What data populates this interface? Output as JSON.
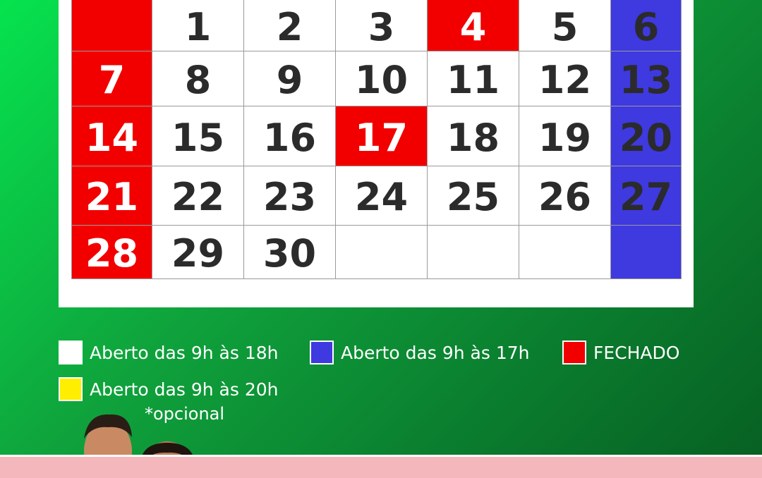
{
  "calendar": {
    "rows": [
      [
        {
          "d": "",
          "c": "red"
        },
        {
          "d": "1",
          "c": "white"
        },
        {
          "d": "2",
          "c": "white"
        },
        {
          "d": "3",
          "c": "white"
        },
        {
          "d": "4",
          "c": "red"
        },
        {
          "d": "5",
          "c": "white"
        },
        {
          "d": "6",
          "c": "blue"
        }
      ],
      [
        {
          "d": "7",
          "c": "red"
        },
        {
          "d": "8",
          "c": "white"
        },
        {
          "d": "9",
          "c": "white"
        },
        {
          "d": "10",
          "c": "white"
        },
        {
          "d": "11",
          "c": "white"
        },
        {
          "d": "12",
          "c": "white"
        },
        {
          "d": "13",
          "c": "blue"
        }
      ],
      [
        {
          "d": "14",
          "c": "red"
        },
        {
          "d": "15",
          "c": "white"
        },
        {
          "d": "16",
          "c": "white"
        },
        {
          "d": "17",
          "c": "red"
        },
        {
          "d": "18",
          "c": "white"
        },
        {
          "d": "19",
          "c": "white"
        },
        {
          "d": "20",
          "c": "blue"
        }
      ],
      [
        {
          "d": "21",
          "c": "red"
        },
        {
          "d": "22",
          "c": "white"
        },
        {
          "d": "23",
          "c": "white"
        },
        {
          "d": "24",
          "c": "white"
        },
        {
          "d": "25",
          "c": "white"
        },
        {
          "d": "26",
          "c": "white"
        },
        {
          "d": "27",
          "c": "blue"
        }
      ],
      [
        {
          "d": "28",
          "c": "red"
        },
        {
          "d": "29",
          "c": "white"
        },
        {
          "d": "30",
          "c": "white"
        },
        {
          "d": "",
          "c": "white"
        },
        {
          "d": "",
          "c": "white"
        },
        {
          "d": "",
          "c": "white"
        },
        {
          "d": "",
          "c": "blue"
        }
      ]
    ]
  },
  "legend": {
    "white_label": "Aberto das 9h às 18h",
    "blue_label": "Aberto das 9h às 17h",
    "red_label": "FECHADO",
    "yellow_label": "Aberto das 9h às 20h",
    "optional_note": "*opcional"
  },
  "colors": {
    "red": "#f20000",
    "blue": "#3f39e0",
    "white": "#ffffff",
    "yellow": "#ffee00",
    "green_bg": "#0fa33c",
    "pink_band": "#f4b8bc"
  }
}
